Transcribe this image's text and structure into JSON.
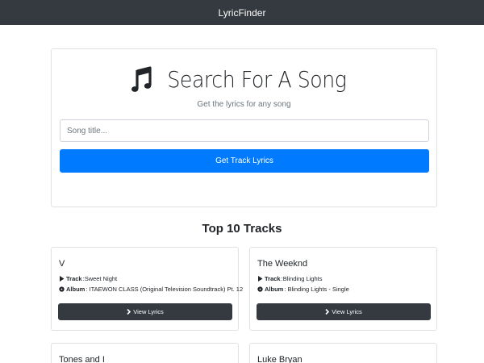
{
  "navbar": {
    "brand": "LyricFinder"
  },
  "search": {
    "icon": "music-note-icon",
    "title": "Search For A Song",
    "subtitle": "Get the lyrics for any song",
    "placeholder": "Song title...",
    "button_label": "Get Track Lyrics"
  },
  "tracks_section": {
    "heading": "Top 10 Tracks",
    "track_label": "Track",
    "album_label": "Album",
    "view_label": "View Lyrics",
    "items": [
      {
        "artist": "V",
        "track": "Sweet Night",
        "album": "ITAEWON CLASS (Original Television Soundtrack) Pt. 12"
      },
      {
        "artist": "The Weeknd",
        "track": "Blinding Lights",
        "album": "Blinding Lights - Single"
      },
      {
        "artist": "Tones and I"
      },
      {
        "artist": "Luke Bryan"
      }
    ]
  },
  "colors": {
    "navbar": "#343a40",
    "primary": "#007bff",
    "dark": "#343a40"
  }
}
